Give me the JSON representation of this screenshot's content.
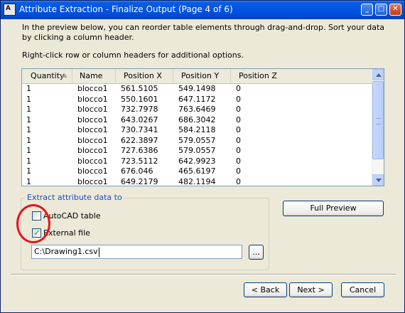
{
  "window": {
    "title": "Attribute Extraction - Finalize Output (Page 4 of 6)",
    "app_icon": "autocad-icon",
    "app_icon_text": "A",
    "controls": {
      "minimize_icon": "minimize-icon",
      "maximize_icon": "maximize-icon",
      "close_icon": "close-icon"
    }
  },
  "instructions": {
    "intro": "In the preview below, you can reorder table elements through drag-and-drop. Sort your data by clicking a column header.",
    "hint": "Right-click row or column headers for additional options."
  },
  "table": {
    "columns": [
      "Quantity",
      "Name",
      "Position X",
      "Position Y",
      "Position Z"
    ],
    "sorted_column": "Quantity",
    "sort_direction": "ascending",
    "rows": [
      [
        "1",
        "blocco1",
        "561.5105",
        "549.1498",
        "0"
      ],
      [
        "1",
        "blocco1",
        "550.1601",
        "647.1172",
        "0"
      ],
      [
        "1",
        "blocco1",
        "732.7978",
        "763.6469",
        "0"
      ],
      [
        "1",
        "blocco1",
        "643.0267",
        "686.3042",
        "0"
      ],
      [
        "1",
        "blocco1",
        "730.7341",
        "584.2118",
        "0"
      ],
      [
        "1",
        "blocco1",
        "622.3897",
        "579.0557",
        "0"
      ],
      [
        "1",
        "blocco1",
        "727.6386",
        "579.0557",
        "0"
      ],
      [
        "1",
        "blocco1",
        "723.5112",
        "642.9923",
        "0"
      ],
      [
        "1",
        "blocco1",
        "676.046",
        "465.6197",
        "0"
      ],
      [
        "1",
        "blocco1",
        "649.2179",
        "482.1194",
        "0"
      ]
    ]
  },
  "extract": {
    "legend": "Extract attribute data to",
    "autocad_table": {
      "label": "AutoCAD table",
      "checked": false
    },
    "external_file": {
      "label": "External file",
      "checked": true
    },
    "file_path": "C:\\Drawing1.csv",
    "browse_label": "..."
  },
  "buttons": {
    "full_preview": "Full Preview",
    "back": "< Back",
    "next": "Next >",
    "cancel": "Cancel"
  },
  "colors": {
    "titlebar": "#0054e3",
    "dialog_bg": "#ece9d8",
    "group_legend": "#1e4ec8",
    "checkmark": "#21a121",
    "annotation": "#e8141b"
  }
}
